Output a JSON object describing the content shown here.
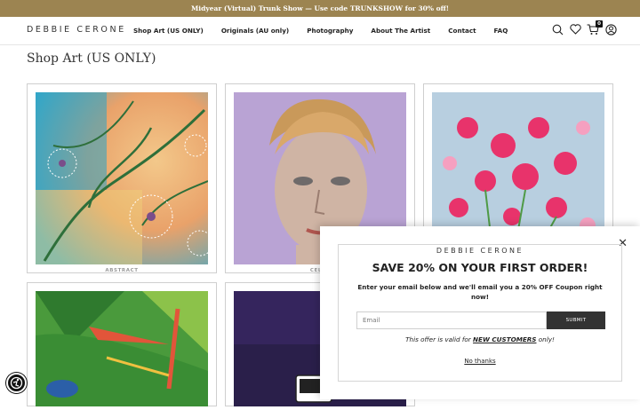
{
  "announcement": "Midyear (Virtual) Trunk Show — Use code TRUNKSHOW for 30% off!",
  "brand": "DEBBIE CERONE",
  "nav": [
    "Shop Art (US ONLY)",
    "Originals (AU only)",
    "Photography",
    "About The Artist",
    "Contact",
    "FAQ"
  ],
  "cart_count": "0",
  "icons": [
    "search-icon",
    "heart-icon",
    "cart-icon",
    "account-icon"
  ],
  "page_title": "Shop Art (US ONLY)",
  "products": [
    {
      "category": "ABSTRACT"
    },
    {
      "category": "CELEB"
    },
    {
      "category": ""
    },
    {
      "category": ""
    },
    {
      "category": ""
    }
  ],
  "popup": {
    "brand": "DEBBIE CERONE",
    "headline": "SAVE 20% ON YOUR FIRST ORDER!",
    "subtext": "Enter your email below and we'll email you a 20% OFF Coupon right now!",
    "email_placeholder": "Email",
    "submit_label": "SUBMIT",
    "note_prefix": "This offer is valid for ",
    "note_emphasis": "NEW CUSTOMERS",
    "note_suffix": " only!",
    "no_thanks": "No thanks"
  },
  "colors": {
    "announce_bg": "#9c8451",
    "submit_bg": "#333333"
  }
}
